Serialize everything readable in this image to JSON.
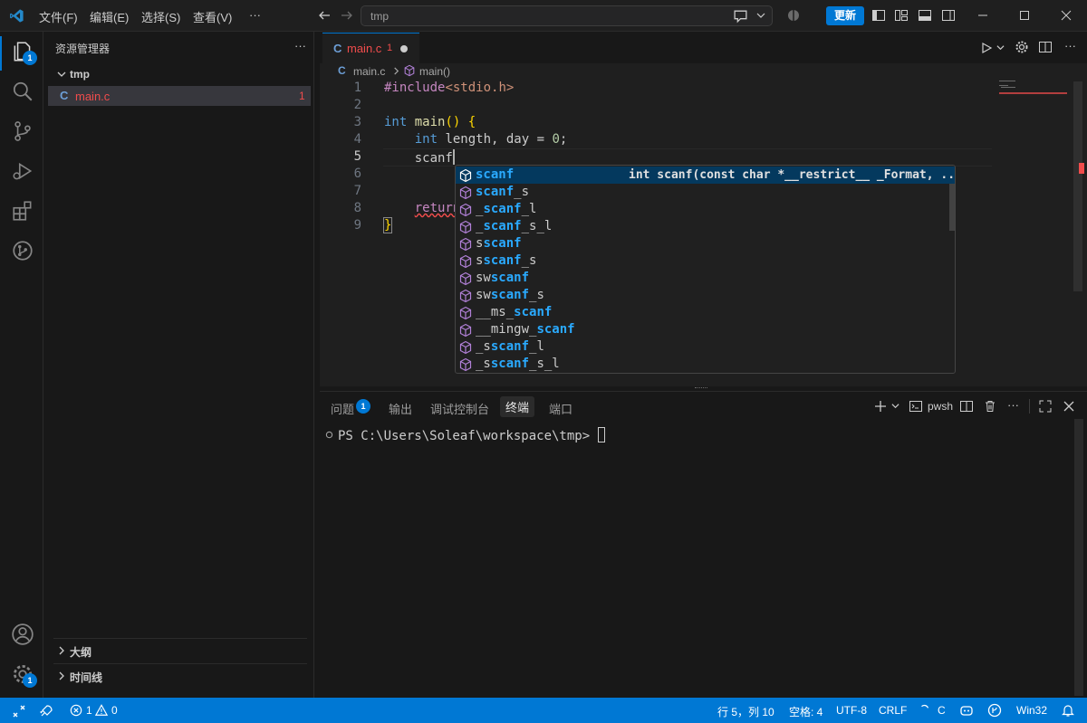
{
  "titlebar": {
    "menus": [
      "文件(F)",
      "编辑(E)",
      "选择(S)",
      "查看(V)",
      "···"
    ],
    "search_text": "tmp",
    "update_label": "更新"
  },
  "activity": {
    "explorer_badge": "1",
    "manage_badge": "1"
  },
  "sidebar": {
    "title": "资源管理器",
    "more": "···",
    "folder": "tmp",
    "file_icon": "C",
    "file_name": "main.c",
    "file_problems": "1",
    "outline_label": "大纲",
    "timeline_label": "时间线"
  },
  "editor": {
    "tab_icon": "C",
    "tab_name": "main.c",
    "tab_problems": "1",
    "breadcrumb_file_icon": "C",
    "breadcrumb_file": "main.c",
    "breadcrumb_symbol": "main()",
    "line_numbers": [
      "1",
      "2",
      "3",
      "4",
      "5",
      "6",
      "7",
      "8",
      "9"
    ],
    "lines": {
      "l1_include": "#include",
      "l1_header": "<stdio.h>",
      "l3_type": "int",
      "l3_name": " main",
      "l3_paren": "()",
      "l3_brace": " {",
      "l4_indent": "    ",
      "l4_type": "int",
      "l4_rest": " length, day = ",
      "l4_num": "0",
      "l4_semi": ";",
      "l5_text": "    scanf",
      "l8_indent": "    ",
      "l8_kw": "return",
      "l9_brace": "}"
    }
  },
  "suggest": {
    "detail": "int scanf(const char *__restrict__ _Format, ...)",
    "items": [
      {
        "pre": "",
        "match": "scanf",
        "post": ""
      },
      {
        "pre": "",
        "match": "scanf",
        "post": "_s"
      },
      {
        "pre": "_",
        "match": "scanf",
        "post": "_l"
      },
      {
        "pre": "_",
        "match": "scanf",
        "post": "_s_l"
      },
      {
        "pre": "s",
        "match": "scanf",
        "post": ""
      },
      {
        "pre": "s",
        "match": "scanf",
        "post": "_s"
      },
      {
        "pre": "sw",
        "match": "scanf",
        "post": ""
      },
      {
        "pre": "sw",
        "match": "scanf",
        "post": "_s"
      },
      {
        "pre": "__ms_",
        "match": "scanf",
        "post": ""
      },
      {
        "pre": "__mingw_",
        "match": "scanf",
        "post": ""
      },
      {
        "pre": "_s",
        "match": "scanf",
        "post": "_l"
      },
      {
        "pre": "_s",
        "match": "scanf",
        "post": "_s_l"
      }
    ]
  },
  "panel": {
    "tabs": [
      "问题",
      "输出",
      "调试控制台",
      "终端",
      "端口"
    ],
    "problems_badge": "1",
    "shell_label": "pwsh",
    "prompt": "PS C:\\Users\\Soleaf\\workspace\\tmp> "
  },
  "status": {
    "errors": "1",
    "warnings": "0",
    "position": "行 5，列 10",
    "spaces": "空格: 4",
    "encoding": "UTF-8",
    "eol": "CRLF",
    "language": "C",
    "platform": "Win32"
  },
  "colors": {
    "accent": "#0078d4",
    "error": "#f14c4c",
    "match_highlight": "#2aaaff"
  }
}
